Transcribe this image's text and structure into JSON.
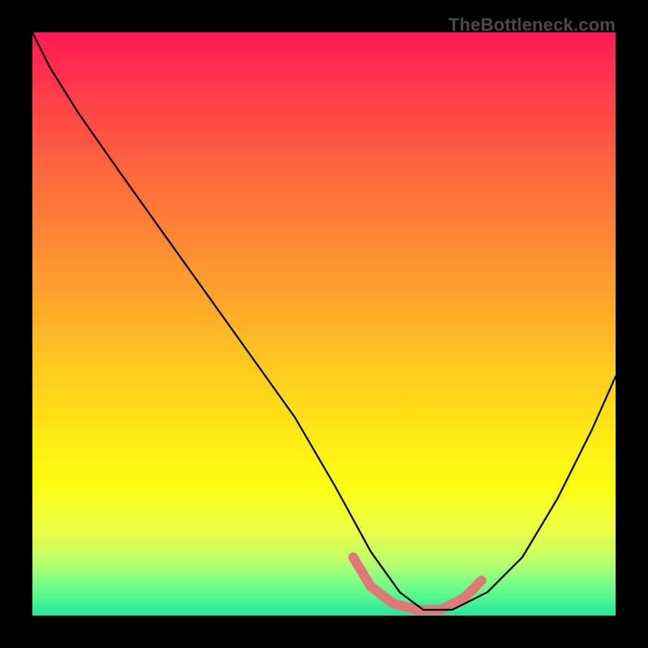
{
  "attribution": "TheBottleneck.com",
  "gradient_colors": {
    "top": "#ff1a55",
    "mid_upper": "#ff9430",
    "mid": "#ffe615",
    "mid_lower": "#b8ff6e",
    "bottom": "#22e89a"
  },
  "curve_style": {
    "main_stroke": "#000000",
    "main_width": 2.2,
    "accent_stroke": "#e07878",
    "accent_width": 12
  },
  "chart_data": {
    "type": "line",
    "title": "",
    "xlabel": "",
    "ylabel": "",
    "xlim": [
      0,
      100
    ],
    "ylim": [
      0,
      100
    ],
    "series": [
      {
        "name": "bottleneck-curve",
        "x": [
          0,
          3,
          8,
          15,
          25,
          35,
          45,
          52,
          58,
          63,
          67,
          72,
          78,
          84,
          90,
          96,
          100
        ],
        "values": [
          100,
          94,
          86,
          76,
          62,
          48,
          34,
          22,
          11,
          4,
          1,
          1,
          4,
          10,
          20,
          32,
          41
        ]
      }
    ],
    "accent_segment": {
      "description": "salmon highlight along curve near trough",
      "x": [
        55,
        58,
        62,
        66,
        70,
        74,
        77
      ],
      "values": [
        10,
        5,
        2,
        1,
        1,
        3,
        6
      ]
    }
  }
}
